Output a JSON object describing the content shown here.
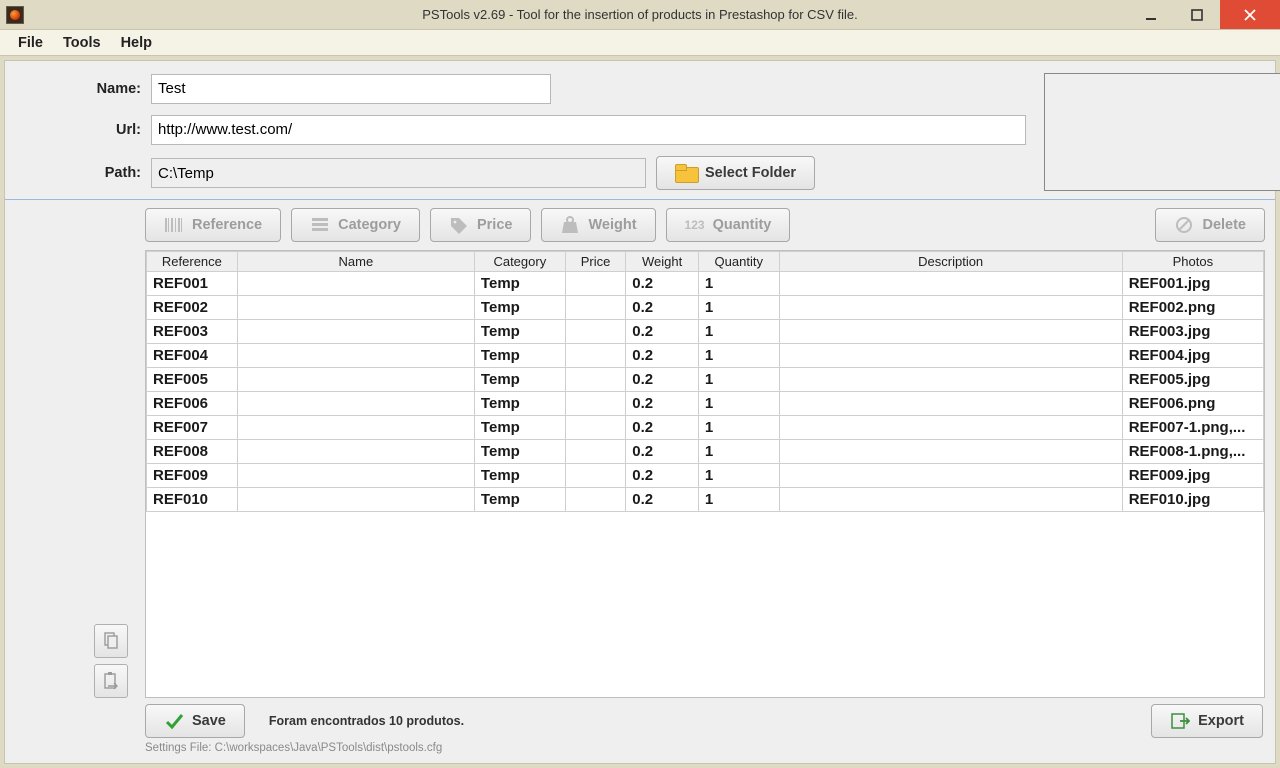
{
  "window": {
    "title": "PSTools v2.69 - Tool for the insertion of products in Prestashop for CSV file."
  },
  "menu": {
    "file": "File",
    "tools": "Tools",
    "help": "Help"
  },
  "form": {
    "name_label": "Name:",
    "name_value": "Test",
    "url_label": "Url:",
    "url_value": "http://www.test.com/",
    "path_label": "Path:",
    "path_value": "C:\\Temp",
    "select_folder": "Select Folder"
  },
  "toolbar": {
    "reference": "Reference",
    "category": "Category",
    "price": "Price",
    "weight": "Weight",
    "quantity": "Quantity",
    "delete": "Delete"
  },
  "table": {
    "headers": {
      "reference": "Reference",
      "name": "Name",
      "category": "Category",
      "price": "Price",
      "weight": "Weight",
      "quantity": "Quantity",
      "description": "Description",
      "photos": "Photos"
    },
    "rows": [
      {
        "reference": "REF001",
        "name": "",
        "category": "Temp",
        "price": "",
        "weight": "0.2",
        "quantity": "1",
        "description": "",
        "photos": "REF001.jpg"
      },
      {
        "reference": "REF002",
        "name": "",
        "category": "Temp",
        "price": "",
        "weight": "0.2",
        "quantity": "1",
        "description": "",
        "photos": "REF002.png"
      },
      {
        "reference": "REF003",
        "name": "",
        "category": "Temp",
        "price": "",
        "weight": "0.2",
        "quantity": "1",
        "description": "",
        "photos": "REF003.jpg"
      },
      {
        "reference": "REF004",
        "name": "",
        "category": "Temp",
        "price": "",
        "weight": "0.2",
        "quantity": "1",
        "description": "",
        "photos": "REF004.jpg"
      },
      {
        "reference": "REF005",
        "name": "",
        "category": "Temp",
        "price": "",
        "weight": "0.2",
        "quantity": "1",
        "description": "",
        "photos": "REF005.jpg"
      },
      {
        "reference": "REF006",
        "name": "",
        "category": "Temp",
        "price": "",
        "weight": "0.2",
        "quantity": "1",
        "description": "",
        "photos": "REF006.png"
      },
      {
        "reference": "REF007",
        "name": "",
        "category": "Temp",
        "price": "",
        "weight": "0.2",
        "quantity": "1",
        "description": "",
        "photos": "REF007-1.png,..."
      },
      {
        "reference": "REF008",
        "name": "",
        "category": "Temp",
        "price": "",
        "weight": "0.2",
        "quantity": "1",
        "description": "",
        "photos": "REF008-1.png,..."
      },
      {
        "reference": "REF009",
        "name": "",
        "category": "Temp",
        "price": "",
        "weight": "0.2",
        "quantity": "1",
        "description": "",
        "photos": "REF009.jpg"
      },
      {
        "reference": "REF010",
        "name": "",
        "category": "Temp",
        "price": "",
        "weight": "0.2",
        "quantity": "1",
        "description": "",
        "photos": "REF010.jpg"
      }
    ]
  },
  "bottom": {
    "save": "Save",
    "status": "Foram encontrados 10 produtos.",
    "export": "Export",
    "settings_file": "Settings File: C:\\workspaces\\Java\\PSTools\\dist\\pstools.cfg"
  }
}
